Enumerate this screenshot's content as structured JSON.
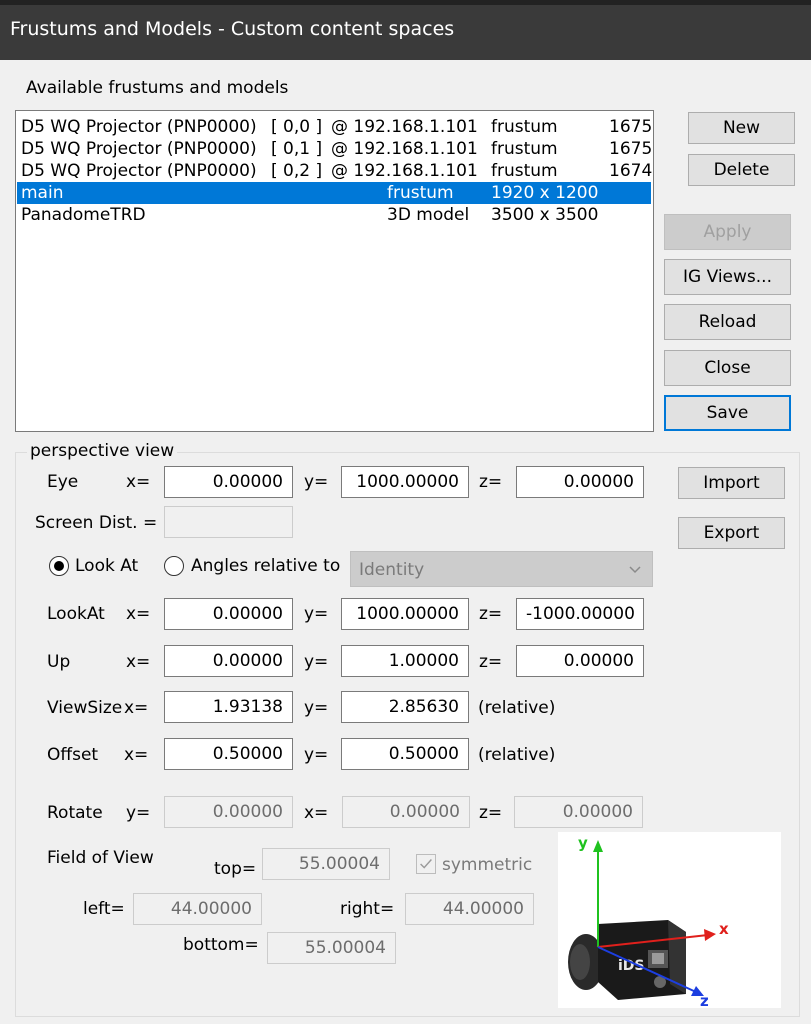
{
  "window": {
    "title": "Frustums and Models - Custom content spaces"
  },
  "available_label": "Available frustums and models",
  "list_rows": [
    {
      "name": "D5 WQ Projector (PNP0000)",
      "index": "[ 0,0 ]",
      "address": "@ 192.168.1.101",
      "type": "frustum",
      "size": "1675",
      "selected": false
    },
    {
      "name": "D5 WQ Projector (PNP0000)",
      "index": "[ 0,1 ]",
      "address": "@ 192.168.1.101",
      "type": "frustum",
      "size": "1675",
      "selected": false
    },
    {
      "name": "D5 WQ Projector (PNP0000)",
      "index": "[ 0,2 ]",
      "address": "@ 192.168.1.101",
      "type": "frustum",
      "size": "1674",
      "selected": false
    },
    {
      "name": "main",
      "index": "",
      "address": "",
      "type": "frustum",
      "size": "1920 x 1200",
      "selected": true
    },
    {
      "name": "PanadomeTRD",
      "index": "",
      "address": "",
      "type": "3D model",
      "size": "3500 x 3500",
      "selected": false
    }
  ],
  "buttons": {
    "new": "New",
    "delete": "Delete",
    "apply": "Apply",
    "ig_views": "IG Views...",
    "reload": "Reload",
    "close": "Close",
    "save": "Save",
    "import": "Import",
    "export": "Export"
  },
  "perspective": {
    "group_title": "perspective view",
    "eye_label": "Eye",
    "screen_dist_label": "Screen Dist. =",
    "screen_dist_value": "",
    "look_at_radio": "Look At",
    "angles_radio": "Angles relative to",
    "angles_combo_value": "Identity",
    "lookat_label": "LookAt",
    "up_label": "Up",
    "viewsize_label": "ViewSize",
    "offset_label": "Offset",
    "rotate_label": "Rotate",
    "relative": "(relative)",
    "x_eq": "x=",
    "y_eq": "y=",
    "z_eq": "z=",
    "eye": {
      "x": "0.00000",
      "y": "1000.00000",
      "z": "0.00000"
    },
    "lookat": {
      "x": "0.00000",
      "y": "1000.00000",
      "z": "-1000.00000"
    },
    "up": {
      "x": "0.00000",
      "y": "1.00000",
      "z": "0.00000"
    },
    "viewsize": {
      "x": "1.93138",
      "y": "2.85630"
    },
    "offset": {
      "x": "0.50000",
      "y": "0.50000"
    },
    "rotate": {
      "y": "0.00000",
      "x": "0.00000",
      "z": "0.00000"
    }
  },
  "fov": {
    "label": "Field of View",
    "top_label": "top=",
    "top": "55.00004",
    "left_label": "left=",
    "left": "44.00000",
    "right_label": "right=",
    "right": "44.00000",
    "bottom_label": "bottom=",
    "bottom": "55.00004",
    "symmetric_label": "symmetric"
  },
  "preview_axes": {
    "y": "y",
    "x": "x",
    "z": "z",
    "camera_text": "iDS"
  },
  "colors": {
    "selection": "#0078d7",
    "axis_x": "#e0201c",
    "axis_y": "#1fc21f",
    "axis_z": "#1c3ee0"
  }
}
